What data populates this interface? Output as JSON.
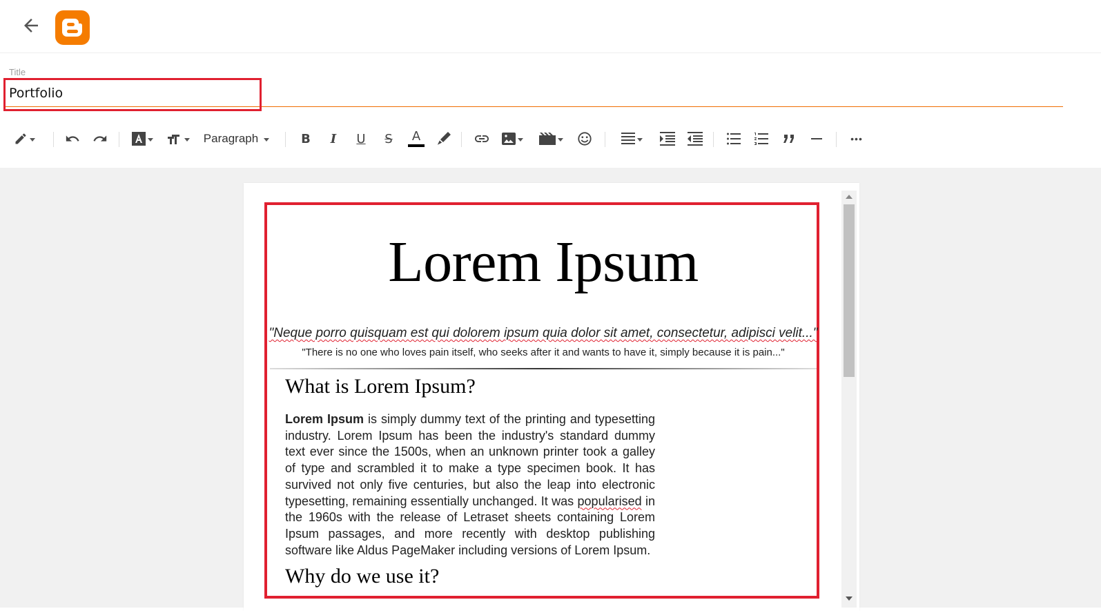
{
  "title_field": {
    "label": "Title",
    "value": "Portfolio"
  },
  "toolbar": {
    "paragraph_label": "Paragraph",
    "icons": [
      "pencil-mode-icon",
      "undo-icon",
      "redo-icon",
      "text-style-icon",
      "font-size-icon",
      "bold-icon",
      "italic-icon",
      "underline-icon",
      "strikethrough-icon",
      "text-color-icon",
      "highlight-icon",
      "link-icon",
      "image-icon",
      "video-icon",
      "emoji-icon",
      "align-icon",
      "indent-icon",
      "outdent-icon",
      "bulleted-list-icon",
      "numbered-list-icon",
      "quote-icon",
      "horizontal-rule-icon",
      "more-icon"
    ],
    "bold_glyph": "B",
    "italic_glyph": "I",
    "underline_glyph": "U",
    "strike_glyph": "S",
    "textcolor_glyph": "A",
    "quote_glyph": "””",
    "more_glyph": "•••"
  },
  "document": {
    "title": "Lorem Ipsum",
    "quote_latin": "\"Neque porro quisquam est qui dolorem ipsum quia dolor sit amet, consectetur, adipisci velit...\"",
    "quote_english": "\"There is no one who loves pain itself, who seeks after it and wants to have it, simply because it is pain...\"",
    "heading1": "What is Lorem Ipsum?",
    "para_bold": "Lorem Ipsum",
    "para_1": " is simply dummy text of the printing and typesetting industry. Lorem Ipsum has been the industry's standard dummy text ever since the 1500s, when an unknown printer took a galley of type and scrambled it to make a type specimen book. It has survived not only five centuries, but also the leap into electronic typesetting, remaining essentially unchanged. It was ",
    "para_misspelled": "popularised",
    "para_2": " in the 1960s with the release of Letraset sheets containing Lorem Ipsum passages, and more recently with desktop publishing software like Aldus PageMaker including versions of Lorem Ipsum.",
    "heading2": "Why do we use it?"
  },
  "colors": {
    "accent": "#ef6c00",
    "highlight_box": "#e02030",
    "logo": "#f57c00"
  }
}
